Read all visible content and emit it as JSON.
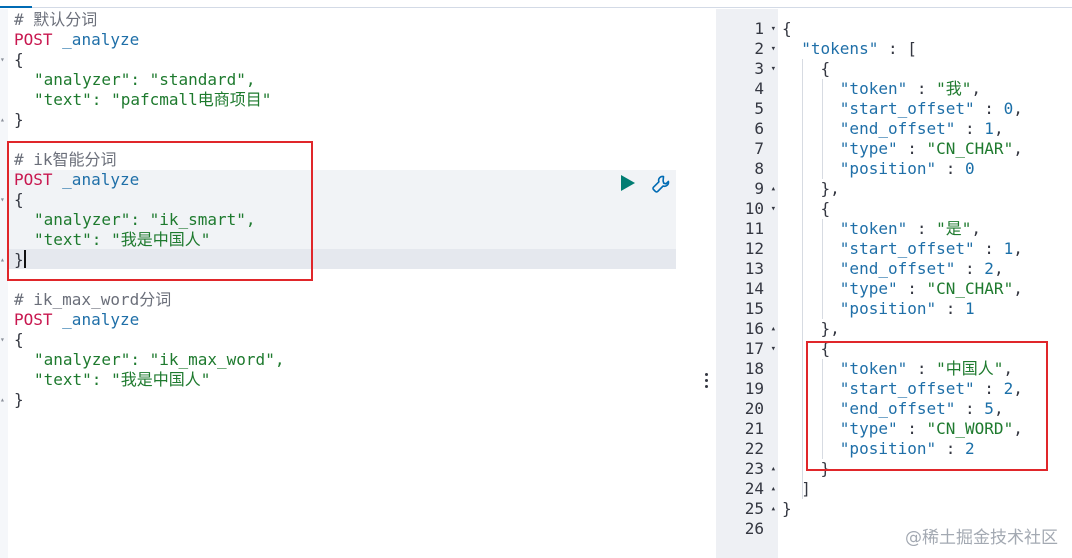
{
  "request_editor": {
    "blocks": [
      {
        "comment": "# 默认分词",
        "method": "POST",
        "path": "_analyze",
        "open": "{",
        "analyzer_line": "\"analyzer\": \"standard\",",
        "text_line": "\"text\": \"pafcmall电商项目\"",
        "close": "}"
      },
      {
        "comment": "# ik智能分词",
        "method": "POST",
        "path": "_analyze",
        "open": "{",
        "analyzer_line": "\"analyzer\": \"ik_smart\",",
        "text_line": "\"text\": \"我是中国人\"",
        "close": "}"
      },
      {
        "comment": "# ik_max_word分词",
        "method": "POST",
        "path": "_analyze",
        "open": "{",
        "analyzer_line": "\"analyzer\": \"ik_max_word\",",
        "text_line": "\"text\": \"我是中国人\"",
        "close": "}"
      }
    ]
  },
  "toolbar": {
    "run_icon": "play-icon",
    "settings_icon": "wrench-icon"
  },
  "response_viewer": {
    "line_numbers": [
      "1",
      "2",
      "3",
      "4",
      "5",
      "6",
      "7",
      "8",
      "9",
      "10",
      "11",
      "12",
      "13",
      "14",
      "15",
      "16",
      "17",
      "18",
      "19",
      "20",
      "21",
      "22",
      "23",
      "24",
      "25",
      "26"
    ],
    "lines": [
      "{",
      "  \"tokens\" : [",
      "    {",
      "      \"token\" : \"我\",",
      "      \"start_offset\" : 0,",
      "      \"end_offset\" : 1,",
      "      \"type\" : \"CN_CHAR\",",
      "      \"position\" : 0",
      "    },",
      "    {",
      "      \"token\" : \"是\",",
      "      \"start_offset\" : 1,",
      "      \"end_offset\" : 2,",
      "      \"type\" : \"CN_CHAR\",",
      "      \"position\" : 1",
      "    },",
      "    {",
      "      \"token\" : \"中国人\",",
      "      \"start_offset\" : 2,",
      "      \"end_offset\" : 5,",
      "      \"type\" : \"CN_WORD\",",
      "      \"position\" : 2",
      "    }",
      "  ]",
      "}",
      ""
    ]
  },
  "watermark": "@稀土掘金技术社区",
  "colors": {
    "accent": "#006bb4",
    "highlight_box": "#e0262a",
    "run_button": "#017d73"
  }
}
